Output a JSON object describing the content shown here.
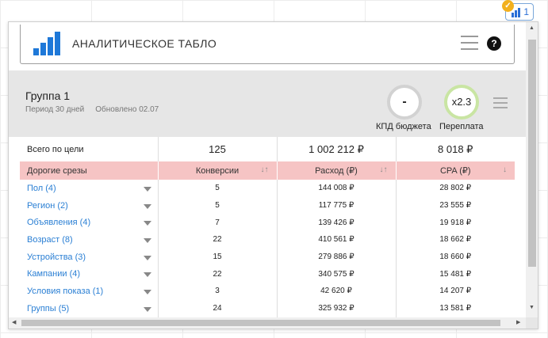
{
  "extension": {
    "badge_count": "1"
  },
  "header": {
    "title": "АНАЛИТИЧЕСКОЕ ТАБЛО",
    "help_label": "?"
  },
  "group": {
    "name": "Группа 1",
    "period": "Период 30 дней",
    "updated": "Обновлено 02.07",
    "kpd_value": "-",
    "kpd_label": "КПД бюджета",
    "overpay_value": "x2.3",
    "overpay_label": "Переплата"
  },
  "totals": {
    "label": "Всего по цели",
    "conversions": "125",
    "cost": "1 002 212 ₽",
    "cpa": "8 018 ₽"
  },
  "columns": {
    "slices": "Дорогие срезы",
    "conversions": "Конверсии",
    "cost": "Расход (₽)",
    "cpa": "CPA (₽)"
  },
  "rows": [
    {
      "slice": "Пол (4)",
      "conversions": "5",
      "cost": "144 008 ₽",
      "cpa": "28 802 ₽"
    },
    {
      "slice": "Регион (2)",
      "conversions": "5",
      "cost": "117 775 ₽",
      "cpa": "23 555 ₽"
    },
    {
      "slice": "Объявления (4)",
      "conversions": "7",
      "cost": "139 426 ₽",
      "cpa": "19 918 ₽"
    },
    {
      "slice": "Возраст (8)",
      "conversions": "22",
      "cost": "410 561 ₽",
      "cpa": "18 662 ₽"
    },
    {
      "slice": "Устройства (3)",
      "conversions": "15",
      "cost": "279 886 ₽",
      "cpa": "18 660 ₽"
    },
    {
      "slice": "Кампании (4)",
      "conversions": "22",
      "cost": "340 575 ₽",
      "cpa": "15 481 ₽"
    },
    {
      "slice": "Условия показа (1)",
      "conversions": "3",
      "cost": "42 620 ₽",
      "cpa": "14 207 ₽"
    },
    {
      "slice": "Группы (5)",
      "conversions": "24",
      "cost": "325 932 ₽",
      "cpa": "13 581 ₽"
    }
  ],
  "colors": {
    "accent": "#1e78d8",
    "link": "#2a7fd4",
    "header_row": "#f6c4c4",
    "group_panel": "#e6e6e6",
    "overpay_ring": "#c9e5a3"
  },
  "icons": {
    "logo": "bar-chart-icon",
    "menu": "hamburger-icon",
    "help": "question-icon",
    "sort": "sort-arrows-icon",
    "expand": "caret-down-icon"
  }
}
